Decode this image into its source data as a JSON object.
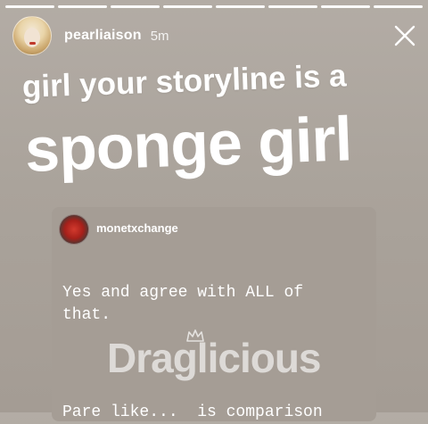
{
  "story": {
    "progress_segments": 8,
    "segments_completed": 8,
    "username": "pearliaison",
    "time": "5m"
  },
  "caption": {
    "line1": "girl your storyline is a",
    "line2": "sponge girl"
  },
  "shared_post": {
    "username": "monetxchange",
    "text": "Yes and agree with ALL of\nthat.",
    "text_partial": "Pare like...  is comparison"
  },
  "watermark": {
    "text": "Draglicious"
  },
  "icons": {
    "close": "close-icon",
    "crown": "crown-icon"
  }
}
